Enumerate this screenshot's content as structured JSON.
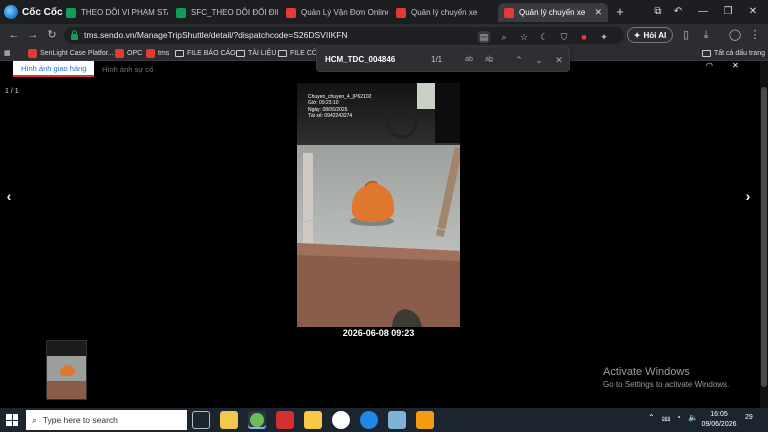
{
  "browser": {
    "brand": "Cốc Cốc",
    "tabs": [
      {
        "title": "THEO DÕI VI PHẠM STATI",
        "favicon": "sheets-icon",
        "active": false
      },
      {
        "title": "SFC_THEO DÕI ĐỔI ĐIỂM",
        "favicon": "sheets-icon",
        "active": false
      },
      {
        "title": "Quản Lý Vận Đơn Online C",
        "favicon": "sendo-icon",
        "active": false
      },
      {
        "title": "Quản lý chuyến xe",
        "favicon": "sendo-icon",
        "active": false
      },
      {
        "title": "Quản lý chuyến xe",
        "favicon": "sendo-icon",
        "active": true
      }
    ],
    "url": "tms.sendo.vn/ManageTripShuttle/detail/?dispatchcode=S26DSVIIKFN",
    "ask_ai_label": "Hỏi AI",
    "bookmarks": [
      {
        "label": "SenLight Case Platfor...",
        "icon": "sendo-icon"
      },
      {
        "label": "OPC",
        "icon": "sendo-icon"
      },
      {
        "label": "tms",
        "icon": "sendo-icon"
      },
      {
        "label": "FILE BÁO CÁO",
        "icon": "folder-icon"
      },
      {
        "label": "TÀI LIỆU",
        "icon": "folder-icon"
      },
      {
        "label": "FILE CÔN",
        "icon": "folder-icon"
      }
    ],
    "all_bookmarks_label": "Tất cả dấu trang",
    "find": {
      "query": "HCM_TDC_004846",
      "count": "1/1"
    }
  },
  "page": {
    "tabs": {
      "active": "Hình ảnh giao hàng",
      "inactive": "Hình ảnh sự cố"
    },
    "counter": "1 / 1",
    "photo_stamp": [
      "Chuyen_chuyen_4_(P62102",
      "Giờ: 09:23:10",
      "Ngày: 08/06/2026",
      "Tài xế: 0942243274"
    ],
    "caption": "2026-06-08 09:23",
    "activation": {
      "title": "Activate Windows",
      "subtitle": "Go to Settings to activate Windows."
    }
  },
  "taskbar": {
    "search_placeholder": "Type here to search",
    "time": "16:05",
    "date": "09/06/2026",
    "notification_count": "29"
  },
  "colors": {
    "accent": "#1a73e8",
    "sendo_red": "#e53935",
    "sheets_green": "#0f9d58"
  }
}
